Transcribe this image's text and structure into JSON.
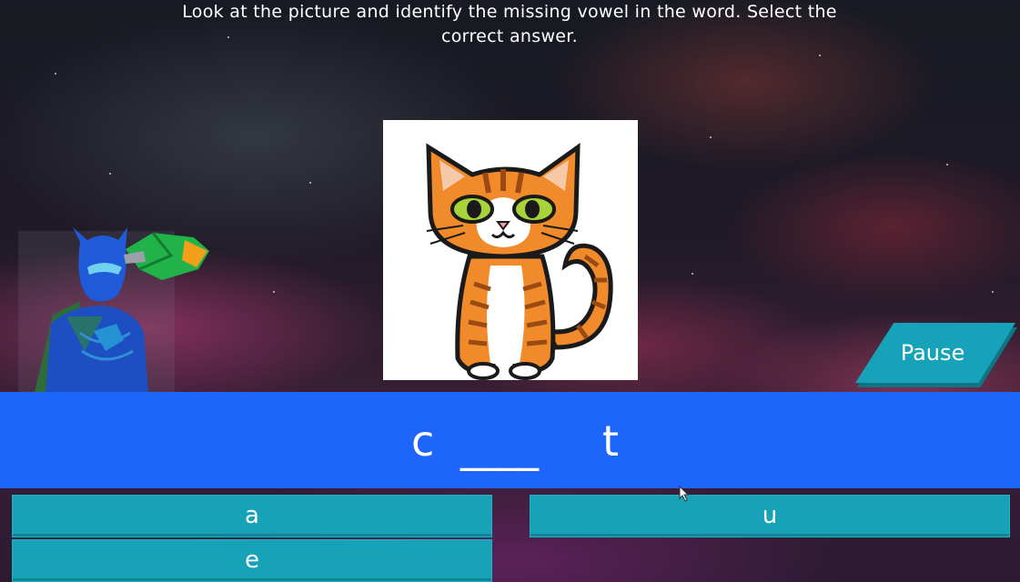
{
  "instruction": {
    "line1": "Look at the picture and identify the missing vowel in the word. Select the",
    "line2": "correct answer."
  },
  "picture": {
    "icon": "cat-picture",
    "subject": "cat"
  },
  "word": {
    "first_letter": "c",
    "blank": "____",
    "last_letter": "t"
  },
  "pause": {
    "label": "Pause"
  },
  "answers": [
    {
      "label": "a"
    },
    {
      "label": "u"
    },
    {
      "label": "e"
    }
  ],
  "colors": {
    "word_bar": "#1e66fb",
    "answer_button": "#17a2b8",
    "pause_button": "#16a2b8"
  }
}
